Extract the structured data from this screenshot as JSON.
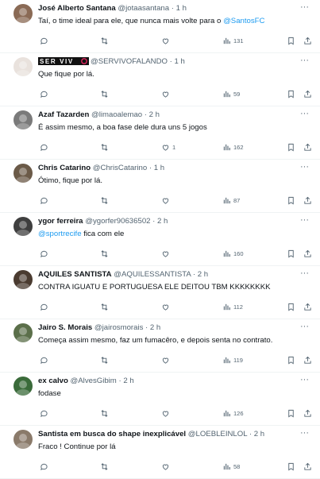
{
  "tweets": [
    {
      "name": "José Alberto Santana",
      "handle": "@jotaasantana",
      "time": "1 h",
      "text": "Taí, o time ideal para ele, que nunca mais volte para o",
      "mention_after": "@SantosFC",
      "mention_before": "",
      "views": "131",
      "likes": "",
      "avatar_color": "#8a6a55"
    },
    {
      "name": "",
      "handle": "@SERVIVOFALANDO",
      "time": "1 h",
      "logo": "SER VIVO",
      "text": "Que fique por lá.",
      "mention_after": "",
      "mention_before": "",
      "views": "59",
      "likes": "",
      "avatar_color": "#e9e2dd"
    },
    {
      "name": "Azaf Tazarden",
      "handle": "@limaoalemao",
      "time": "2 h",
      "text": "É assim mesmo, a boa fase dele dura uns 5 jogos",
      "mention_after": "",
      "mention_before": "",
      "views": "162",
      "likes": "1",
      "avatar_color": "#7a7a7a"
    },
    {
      "name": "Chris Catarino",
      "handle": "@ChrisCatarino",
      "time": "1 h",
      "text": "Ótimo, fique por lá.",
      "mention_after": "",
      "mention_before": "",
      "views": "87",
      "likes": "",
      "avatar_color": "#6b5a48"
    },
    {
      "name": "ygor ferreira",
      "handle": "@ygorfer90636502",
      "time": "2 h",
      "text": " fica com ele",
      "mention_after": "",
      "mention_before": "@sportrecife",
      "views": "160",
      "likes": "",
      "avatar_color": "#3f3f3f"
    },
    {
      "name": "AQUILES SANTISTA",
      "handle": "@AQUILESSANTISTA",
      "time": "2 h",
      "text": "CONTRA IGUATU E PORTUGUESA ELE DEITOU TBM KKKKKKKK",
      "mention_after": "",
      "mention_before": "",
      "views": "112",
      "likes": "",
      "avatar_color": "#4a3b30"
    },
    {
      "name": "Jairo S. Morais",
      "handle": "@jairosmorais",
      "time": "2 h",
      "text": "Começa assim mesmo, faz um fumacêro, e depois senta no contrato.",
      "mention_after": "",
      "mention_before": "",
      "views": "119",
      "likes": "",
      "avatar_color": "#5b6f4a"
    },
    {
      "name": "ex calvo",
      "handle": "@AlvesGibim",
      "time": "2 h",
      "text": "fodase",
      "mention_after": "",
      "mention_before": "",
      "views": "126",
      "likes": "",
      "avatar_color": "#3a6b3a"
    },
    {
      "name": "Santista em busca do shape inexplicável",
      "handle": "@LOEBLEINLOL",
      "time": "2 h",
      "text": "Fraco ! Continue por lá",
      "mention_after": "",
      "mention_before": "",
      "views": "58",
      "likes": "",
      "avatar_color": "#8a7a6a"
    }
  ]
}
